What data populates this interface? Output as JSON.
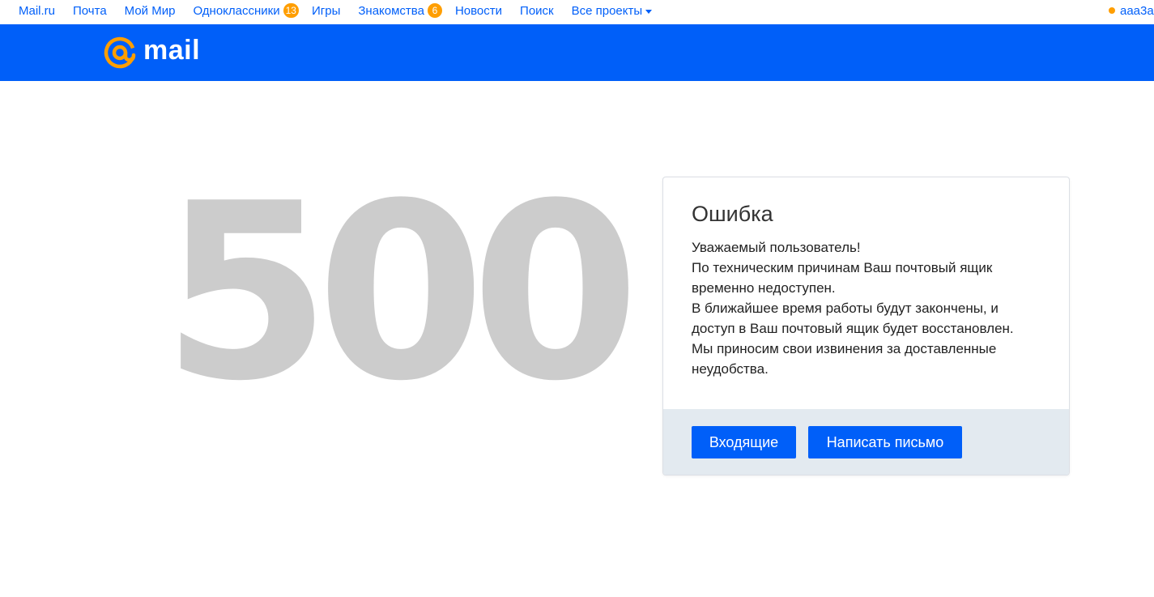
{
  "portal_nav": {
    "items": [
      {
        "label": "Mail.ru"
      },
      {
        "label": "Почта"
      },
      {
        "label": "Мой Мир"
      },
      {
        "label": "Одноклассники",
        "badge": "13"
      },
      {
        "label": "Игры"
      },
      {
        "label": "Знакомства",
        "badge": "6"
      },
      {
        "label": "Новости"
      },
      {
        "label": "Поиск"
      },
      {
        "label": "Все проекты"
      }
    ],
    "user": "aaa3a"
  },
  "header": {
    "logo_text": "mail"
  },
  "error_code": "500",
  "card": {
    "title": "Ошибка",
    "lines": [
      "Уважаемый пользователь!",
      "По техническим причинам Ваш почтовый ящик",
      "временно недоступен.",
      "В ближайшее время работы будут закончены, и",
      "доступ в Ваш почтовый ящик будет восстановлен.",
      "Мы приносим свои извинения за доставленные",
      "неудобства."
    ],
    "buttons": {
      "inbox": "Входящие",
      "write": "Написать письмо"
    }
  },
  "colors": {
    "brand_blue": "#005ff9",
    "accent_orange": "#ff9e00",
    "code_gray": "#cccccc",
    "footer_bg": "#e3eaf0"
  }
}
